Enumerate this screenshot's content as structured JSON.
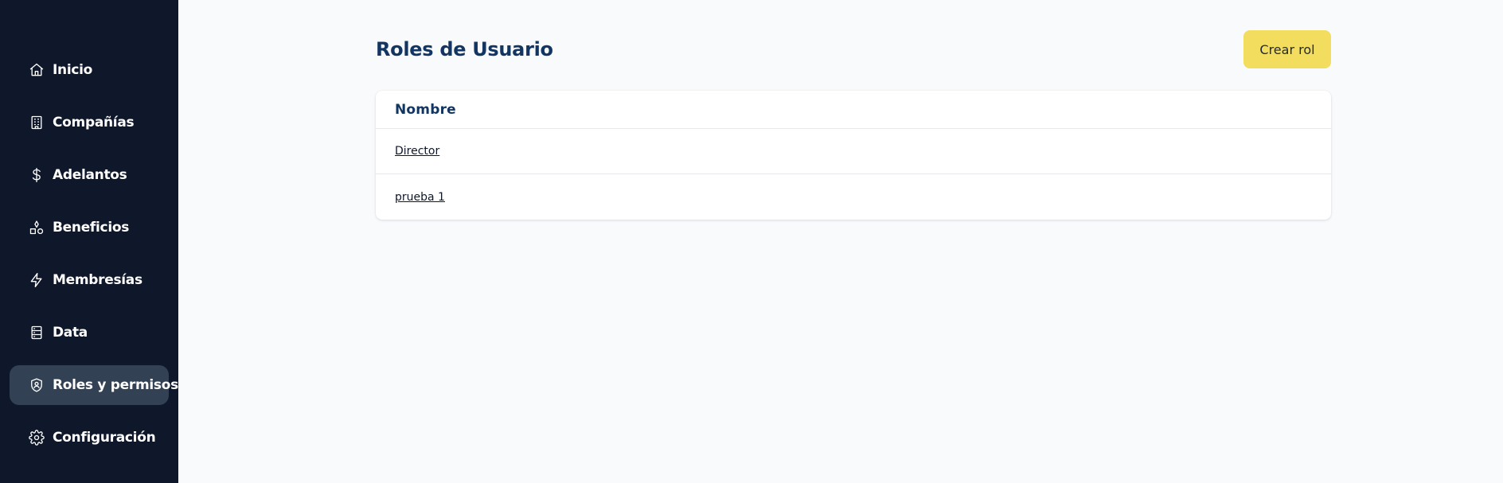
{
  "sidebar": {
    "items": [
      {
        "label": "Inicio",
        "icon": "home-icon"
      },
      {
        "label": "Compañías",
        "icon": "building-icon"
      },
      {
        "label": "Adelantos",
        "icon": "dollar-icon"
      },
      {
        "label": "Beneficios",
        "icon": "shapes-icon"
      },
      {
        "label": "Membresías",
        "icon": "lightning-icon"
      },
      {
        "label": "Data",
        "icon": "server-icon"
      },
      {
        "label": "Roles y permisos",
        "icon": "shield-user-icon",
        "active": true
      },
      {
        "label": "Configuración",
        "icon": "gear-icon"
      }
    ]
  },
  "main": {
    "title": "Roles de Usuario",
    "create_button_label": "Crear rol",
    "table": {
      "columns": [
        "Nombre"
      ],
      "rows": [
        "Director",
        "prueba 1"
      ]
    }
  },
  "colors": {
    "sidebar_bg": "#0f172a",
    "active_item_bg": "#334155",
    "title": "#123561",
    "create_button": "#f3dd5f",
    "page_bg": "#f8fafc"
  }
}
